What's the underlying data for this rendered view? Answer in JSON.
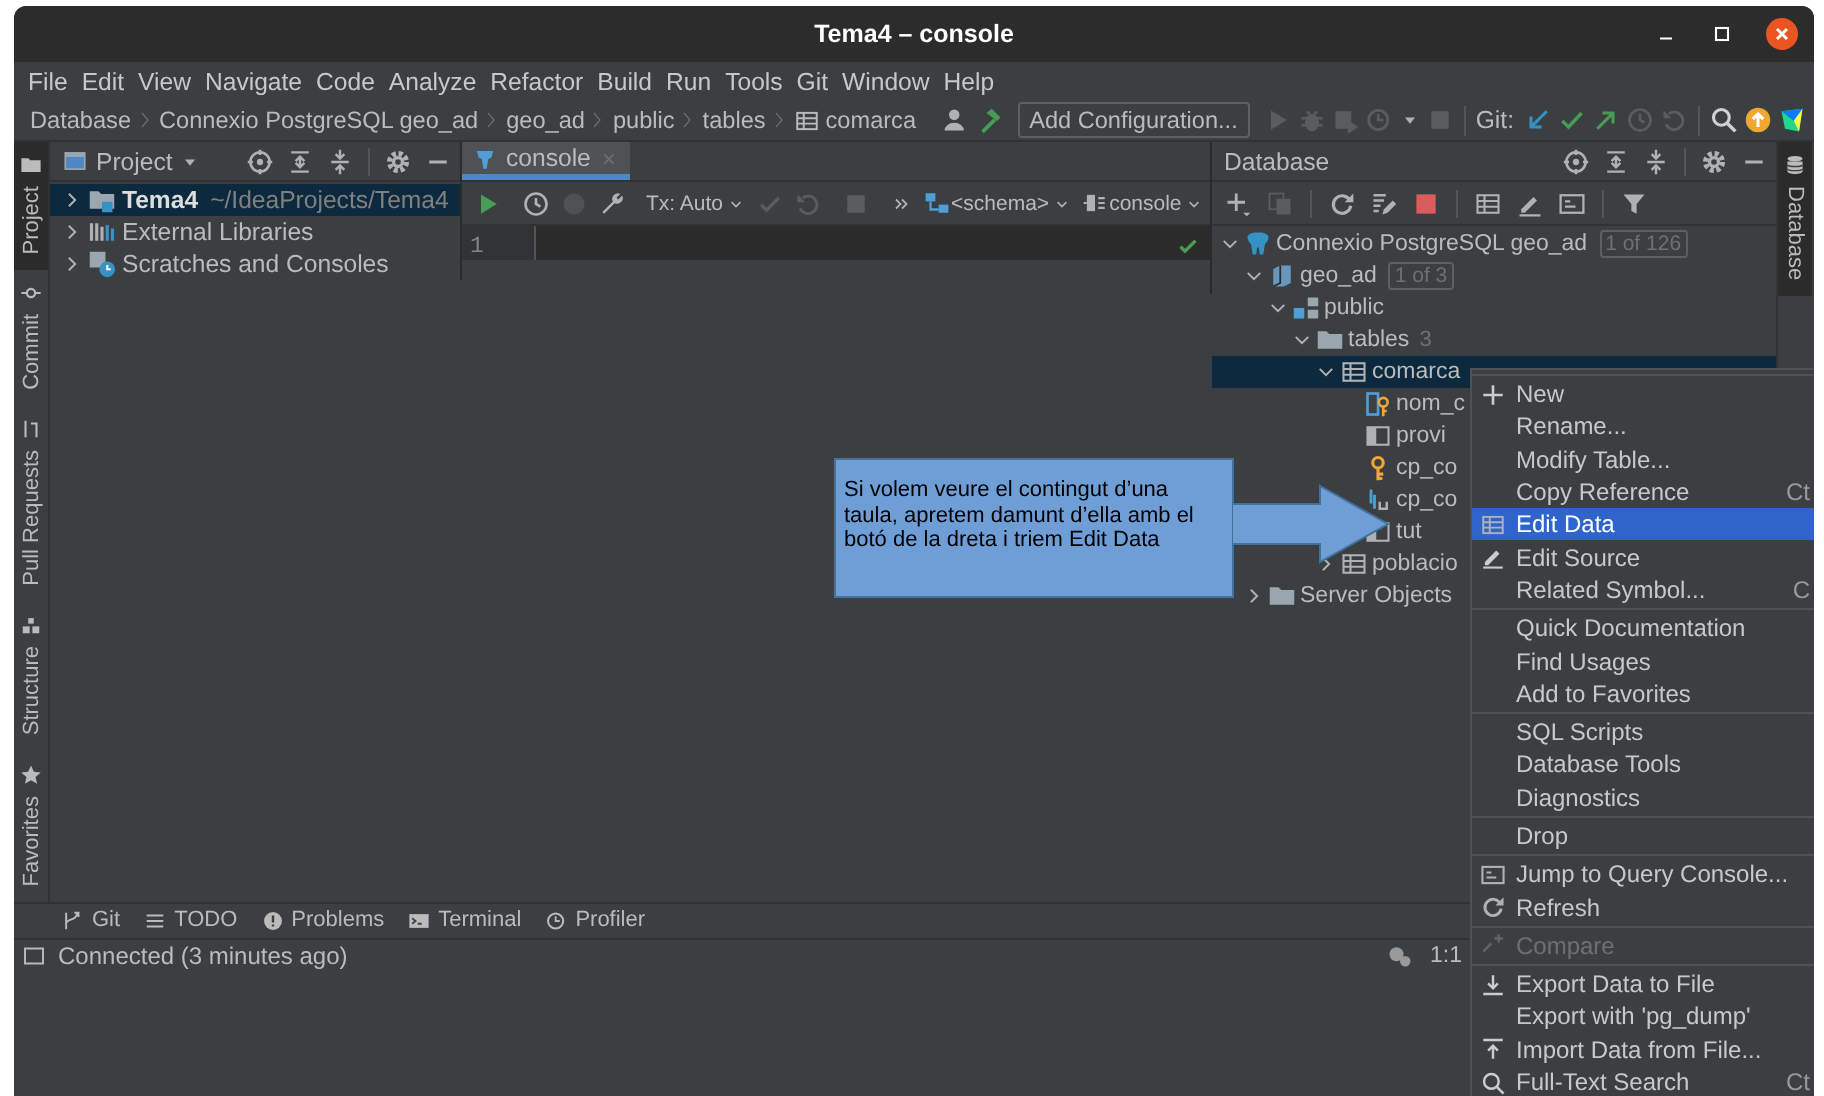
{
  "window": {
    "title": "Tema4 – console"
  },
  "menu_bar": [
    "File",
    "Edit",
    "View",
    "Navigate",
    "Code",
    "Analyze",
    "Refactor",
    "Build",
    "Run",
    "Tools",
    "Git",
    "Window",
    "Help"
  ],
  "breadcrumbs": [
    {
      "label": "Database",
      "kind": "text"
    },
    {
      "label": "Connexio PostgreSQL geo_ad",
      "kind": "text"
    },
    {
      "label": "geo_ad",
      "kind": "text"
    },
    {
      "label": "public",
      "kind": "text"
    },
    {
      "label": "tables",
      "kind": "text"
    },
    {
      "label": "comarca",
      "kind": "table"
    }
  ],
  "toolbar": {
    "run_configuration": "Add Configuration...",
    "git_label": "Git:"
  },
  "left_tool_stripe": {
    "top": [
      {
        "label": "Project",
        "kind": "project",
        "selected": true
      },
      {
        "label": "Commit",
        "kind": "commit",
        "selected": false
      },
      {
        "label": "Pull Requests",
        "kind": "pull_requests",
        "selected": false
      }
    ],
    "bottom": [
      {
        "label": "Structure",
        "kind": "structure",
        "selected": false
      },
      {
        "label": "Favorites",
        "kind": "favorites",
        "selected": false
      }
    ]
  },
  "project_panel": {
    "title": "Project",
    "tree": [
      {
        "label": "Tema4",
        "path": "~/IdeaProjects/Tema4",
        "kind": "module",
        "expanded": false,
        "selected": true
      },
      {
        "label": "External Libraries",
        "kind": "libraries",
        "expanded": false,
        "selected": false
      },
      {
        "label": "Scratches and Consoles",
        "kind": "scratches",
        "expanded": false,
        "selected": false
      }
    ]
  },
  "editor": {
    "tabs": [
      {
        "label": "console",
        "selected": true
      }
    ],
    "tx_mode": "Tx: Auto",
    "schema": "<schema>",
    "session": "console",
    "line_numbers": [
      "1"
    ]
  },
  "database_panel": {
    "title": "Database",
    "tree": [
      {
        "label": "Connexio PostgreSQL geo_ad",
        "badge": "1 of 126",
        "kind": "datasource",
        "expanded": true,
        "selected": false,
        "children": [
          {
            "label": "geo_ad",
            "badge": "1 of 3",
            "kind": "database",
            "expanded": true,
            "selected": false,
            "children": [
              {
                "label": "public",
                "kind": "schema",
                "expanded": true,
                "selected": false,
                "children": [
                  {
                    "label": "tables",
                    "count": "3",
                    "kind": "folder",
                    "expanded": true,
                    "selected": false,
                    "children": [
                      {
                        "label": "comarca",
                        "kind": "table",
                        "expanded": true,
                        "selected": true,
                        "children": [
                          {
                            "label": "nom_c",
                            "kind": "key_column",
                            "selected": false
                          },
                          {
                            "label": "provi",
                            "kind": "column",
                            "selected": false
                          },
                          {
                            "label": "cp_co",
                            "kind": "key",
                            "selected": false
                          },
                          {
                            "label": "cp_co",
                            "kind": "index",
                            "selected": false
                          },
                          {
                            "label": "tut",
                            "kind": "column",
                            "selected": false
                          }
                        ]
                      },
                      {
                        "label": "poblacio",
                        "kind": "table",
                        "expanded": false,
                        "selected": false
                      }
                    ]
                  }
                ]
              }
            ]
          },
          {
            "label": "Server Objects",
            "kind": "folder",
            "expanded": false,
            "selected": false
          }
        ]
      }
    ]
  },
  "right_tool_stripe": [
    {
      "label": "Database",
      "kind": "database",
      "selected": true
    }
  ],
  "callout": {
    "text": "Si volem veure el contingut d’una taula, apretem damunt d’ella amb el botó de la dreta i triem Edit Data"
  },
  "context_menu": {
    "groups": [
      [
        {
          "label": "New",
          "kind": "add",
          "selected": false,
          "disabled": false
        },
        {
          "label": "Rename...",
          "kind": "plain",
          "selected": false,
          "disabled": false
        },
        {
          "label": "Modify Table...",
          "kind": "plain",
          "selected": false,
          "disabled": false
        },
        {
          "label": "Copy Reference",
          "shortcut": "Ct",
          "kind": "plain",
          "selected": false,
          "disabled": false
        },
        {
          "label": "Edit Data",
          "kind": "table",
          "selected": true,
          "disabled": false
        },
        {
          "label": "Edit Source",
          "kind": "edit",
          "selected": false,
          "disabled": false
        },
        {
          "label": "Related Symbol...",
          "shortcut": "C",
          "kind": "plain",
          "selected": false,
          "disabled": false
        }
      ],
      [
        {
          "label": "Quick Documentation",
          "kind": "plain",
          "selected": false,
          "disabled": false
        },
        {
          "label": "Find Usages",
          "kind": "plain",
          "selected": false,
          "disabled": false
        },
        {
          "label": "Add to Favorites",
          "kind": "plain",
          "selected": false,
          "disabled": false
        }
      ],
      [
        {
          "label": "SQL Scripts",
          "kind": "plain",
          "selected": false,
          "disabled": false
        },
        {
          "label": "Database Tools",
          "kind": "plain",
          "selected": false,
          "disabled": false
        },
        {
          "label": "Diagnostics",
          "kind": "plain",
          "selected": false,
          "disabled": false
        }
      ],
      [
        {
          "label": "Drop",
          "kind": "plain",
          "selected": false,
          "disabled": false
        }
      ],
      [
        {
          "label": "Jump to Query Console...",
          "kind": "console",
          "selected": false,
          "disabled": false
        },
        {
          "label": "Refresh",
          "kind": "refresh",
          "selected": false,
          "disabled": false
        }
      ],
      [
        {
          "label": "Compare",
          "kind": "compare",
          "selected": false,
          "disabled": true
        }
      ],
      [
        {
          "label": "Export Data to File",
          "kind": "export",
          "selected": false,
          "disabled": false
        },
        {
          "label": "Export with 'pg_dump'",
          "kind": "plain",
          "selected": false,
          "disabled": false
        },
        {
          "label": "Import Data from File...",
          "kind": "import",
          "selected": false,
          "disabled": false
        },
        {
          "label": "Full-Text Search",
          "shortcut": "Ct",
          "kind": "search",
          "selected": false,
          "disabled": false
        }
      ]
    ]
  },
  "bottom_tool_bar": [
    {
      "label": "Git",
      "kind": "git"
    },
    {
      "label": "TODO",
      "kind": "todo"
    },
    {
      "label": "Problems",
      "kind": "problems"
    },
    {
      "label": "Terminal",
      "kind": "terminal"
    },
    {
      "label": "Profiler",
      "kind": "profiler"
    }
  ],
  "status_bar": {
    "message": "Connected (3 minutes ago)",
    "position": "1:1"
  }
}
